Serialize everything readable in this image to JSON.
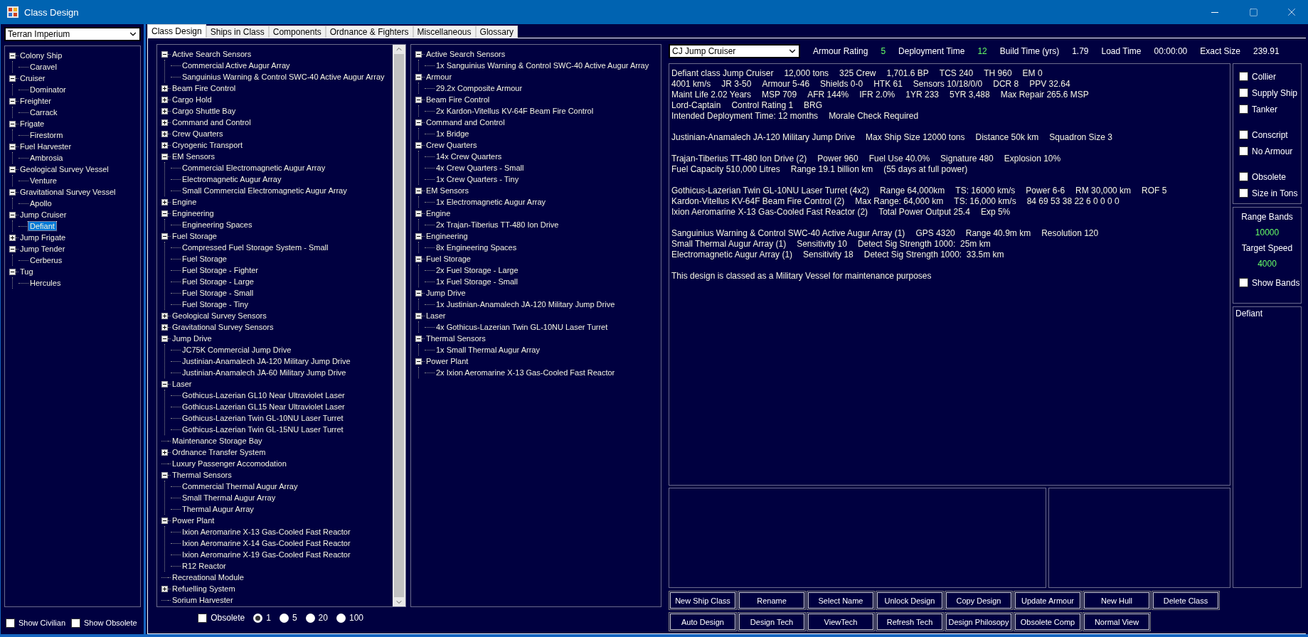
{
  "window": {
    "title": "Class Design"
  },
  "faction_select": {
    "value": "Terran Imperium"
  },
  "hull_tree": [
    {
      "label": "Colony Ship",
      "expanded": true,
      "selected": false,
      "children": [
        {
          "label": "Caravel",
          "selected": false
        }
      ]
    },
    {
      "label": "Cruiser",
      "expanded": true,
      "selected": false,
      "children": [
        {
          "label": "Dominator",
          "selected": false
        }
      ]
    },
    {
      "label": "Freighter",
      "expanded": true,
      "selected": false,
      "children": [
        {
          "label": "Carrack",
          "selected": false
        }
      ]
    },
    {
      "label": "Frigate",
      "expanded": true,
      "selected": false,
      "children": [
        {
          "label": "Firestorm",
          "selected": false
        }
      ]
    },
    {
      "label": "Fuel Harvester",
      "expanded": true,
      "selected": false,
      "children": [
        {
          "label": "Ambrosia",
          "selected": false
        }
      ]
    },
    {
      "label": "Geological Survey Vessel",
      "expanded": true,
      "selected": false,
      "children": [
        {
          "label": "Venture",
          "selected": false
        }
      ]
    },
    {
      "label": "Gravitational Survey Vessel",
      "expanded": true,
      "selected": false,
      "children": [
        {
          "label": "Apollo",
          "selected": false
        }
      ]
    },
    {
      "label": "Jump Cruiser",
      "expanded": true,
      "selected": false,
      "children": [
        {
          "label": "Defiant",
          "selected": true
        }
      ]
    },
    {
      "label": "Jump Frigate",
      "expanded": false,
      "selected": false
    },
    {
      "label": "Jump Tender",
      "expanded": true,
      "selected": false,
      "children": [
        {
          "label": "Cerberus",
          "selected": false
        }
      ]
    },
    {
      "label": "Tug",
      "expanded": true,
      "selected": false,
      "children": [
        {
          "label": "Hercules",
          "selected": false
        }
      ]
    }
  ],
  "left_options": [
    {
      "label": "Show Civilian",
      "checked": false
    },
    {
      "label": "Show Obsolete",
      "checked": false
    }
  ],
  "tabs": [
    {
      "label": "Class Design",
      "selected": true
    },
    {
      "label": "Ships in Class",
      "selected": false
    },
    {
      "label": "Components",
      "selected": false
    },
    {
      "label": "Ordnance & Fighters",
      "selected": false
    },
    {
      "label": "Miscellaneous",
      "selected": false
    },
    {
      "label": "Glossary",
      "selected": false
    }
  ],
  "component_tree": [
    {
      "label": "Active Search Sensors",
      "kind": "group",
      "expanded": true,
      "children": [
        {
          "label": "Commercial Active Augur Array"
        },
        {
          "label": "Sanguinius Warning & Control SWC-40 Active Augur Array"
        }
      ]
    },
    {
      "label": "Beam Fire Control",
      "kind": "group",
      "expanded": false
    },
    {
      "label": "Cargo Hold",
      "kind": "group",
      "expanded": false
    },
    {
      "label": "Cargo Shuttle Bay",
      "kind": "group",
      "expanded": false
    },
    {
      "label": "Command and Control",
      "kind": "group",
      "expanded": false
    },
    {
      "label": "Crew Quarters",
      "kind": "group",
      "expanded": false
    },
    {
      "label": "Cryogenic Transport",
      "kind": "group",
      "expanded": false
    },
    {
      "label": "EM Sensors",
      "kind": "group",
      "expanded": true,
      "children": [
        {
          "label": "Commercial Electromagnetic Augur Array"
        },
        {
          "label": "Electromagnetic Augur Array"
        },
        {
          "label": "Small Commercial Electromagnetic Augur Array"
        }
      ]
    },
    {
      "label": "Engine",
      "kind": "group",
      "expanded": false
    },
    {
      "label": "Engineering",
      "kind": "group",
      "expanded": true,
      "children": [
        {
          "label": "Engineering Spaces"
        }
      ]
    },
    {
      "label": "Fuel Storage",
      "kind": "group",
      "expanded": true,
      "children": [
        {
          "label": "Compressed Fuel Storage System - Small"
        },
        {
          "label": "Fuel Storage"
        },
        {
          "label": "Fuel Storage - Fighter"
        },
        {
          "label": "Fuel Storage - Large"
        },
        {
          "label": "Fuel Storage - Small"
        },
        {
          "label": "Fuel Storage - Tiny"
        }
      ]
    },
    {
      "label": "Geological Survey Sensors",
      "kind": "group",
      "expanded": false
    },
    {
      "label": "Gravitational Survey Sensors",
      "kind": "group",
      "expanded": false
    },
    {
      "label": "Jump Drive",
      "kind": "group",
      "expanded": true,
      "children": [
        {
          "label": "JC75K Commercial Jump Drive"
        },
        {
          "label": "Justinian-Anamalech JA-120 Military Jump Drive"
        },
        {
          "label": "Justinian-Anamalech JA-60 Military Jump Drive"
        }
      ]
    },
    {
      "label": "Laser",
      "kind": "group",
      "expanded": true,
      "children": [
        {
          "label": "Gothicus-Lazerian GL10 Near Ultraviolet Laser"
        },
        {
          "label": "Gothicus-Lazerian GL15 Near Ultraviolet Laser"
        },
        {
          "label": "Gothicus-Lazerian Twin GL-10NU Laser Turret"
        },
        {
          "label": "Gothicus-Lazerian Twin GL-15NU Laser Turret"
        }
      ]
    },
    {
      "label": "Maintenance Storage Bay",
      "kind": "item"
    },
    {
      "label": "Ordnance Transfer System",
      "kind": "group",
      "expanded": false
    },
    {
      "label": "Luxury Passenger Accomodation",
      "kind": "item"
    },
    {
      "label": "Thermal Sensors",
      "kind": "group",
      "expanded": true,
      "children": [
        {
          "label": "Commercial Thermal Augur Array"
        },
        {
          "label": "Small Thermal Augur Array"
        },
        {
          "label": "Thermal Augur Array"
        }
      ]
    },
    {
      "label": "Power Plant",
      "kind": "group",
      "expanded": true,
      "children": [
        {
          "label": "Ixion Aeromarine X-13 Gas-Cooled Fast Reactor"
        },
        {
          "label": "Ixion Aeromarine X-14 Gas-Cooled Fast Reactor"
        },
        {
          "label": "Ixion Aeromarine X-19 Gas-Cooled Fast Reactor"
        },
        {
          "label": "R12 Reactor"
        }
      ]
    },
    {
      "label": "Recreational Module",
      "kind": "item"
    },
    {
      "label": "Refuelling System",
      "kind": "group",
      "expanded": false
    },
    {
      "label": "Sorium Harvester",
      "kind": "item"
    }
  ],
  "component_options": {
    "obsolete": {
      "label": "Obsolete",
      "checked": false
    },
    "counts": [
      {
        "label": "1",
        "selected": true
      },
      {
        "label": "5",
        "selected": false
      },
      {
        "label": "20",
        "selected": false
      },
      {
        "label": "100",
        "selected": false
      }
    ]
  },
  "design_tree": [
    {
      "label": "Active Search Sensors",
      "expanded": true,
      "children": [
        {
          "label": "1x Sanguinius Warning & Control SWC-40 Active Augur Array"
        }
      ]
    },
    {
      "label": "Armour",
      "expanded": true,
      "children": [
        {
          "label": "29.2x Composite Armour"
        }
      ]
    },
    {
      "label": "Beam Fire Control",
      "expanded": true,
      "children": [
        {
          "label": "2x Kardon-Vitellus KV-64F Beam Fire Control"
        }
      ]
    },
    {
      "label": "Command and Control",
      "expanded": true,
      "children": [
        {
          "label": "1x Bridge"
        }
      ]
    },
    {
      "label": "Crew Quarters",
      "expanded": true,
      "children": [
        {
          "label": "14x Crew Quarters"
        },
        {
          "label": "4x Crew Quarters - Small"
        },
        {
          "label": "1x Crew Quarters - Tiny"
        }
      ]
    },
    {
      "label": "EM Sensors",
      "expanded": true,
      "children": [
        {
          "label": "1x Electromagnetic Augur Array"
        }
      ]
    },
    {
      "label": "Engine",
      "expanded": true,
      "children": [
        {
          "label": "2x Trajan-Tiberius TT-480 Ion Drive"
        }
      ]
    },
    {
      "label": "Engineering",
      "expanded": true,
      "children": [
        {
          "label": "8x Engineering Spaces"
        }
      ]
    },
    {
      "label": "Fuel Storage",
      "expanded": true,
      "children": [
        {
          "label": "2x Fuel Storage - Large"
        },
        {
          "label": "1x Fuel Storage - Small"
        }
      ]
    },
    {
      "label": "Jump Drive",
      "expanded": true,
      "children": [
        {
          "label": "1x Justinian-Anamalech JA-120 Military Jump Drive"
        }
      ]
    },
    {
      "label": "Laser",
      "expanded": true,
      "children": [
        {
          "label": "4x Gothicus-Lazerian Twin GL-10NU Laser Turret"
        }
      ]
    },
    {
      "label": "Thermal Sensors",
      "expanded": true,
      "children": [
        {
          "label": "1x Small Thermal Augur Array"
        }
      ]
    },
    {
      "label": "Power Plant",
      "expanded": true,
      "children": [
        {
          "label": "2x Ixion Aeromarine X-13 Gas-Cooled Fast Reactor"
        }
      ]
    }
  ],
  "class_select": {
    "value": "CJ Jump Cruiser"
  },
  "stats": [
    {
      "label": "Armour Rating",
      "value": "5",
      "color": "#66ff66"
    },
    {
      "label": "Deployment Time",
      "value": "12",
      "color": "#66ff66"
    },
    {
      "label": "Build Time (yrs)",
      "value": "1.79",
      "color": "#ffffff"
    },
    {
      "label": "Load Time",
      "value": "00:00:00",
      "color": "#ffffff"
    },
    {
      "label": "Exact Size",
      "value": "239.91",
      "color": "#ffffff"
    }
  ],
  "summary": [
    [
      [
        "Defiant class Jump Cruiser",
        "12,000 tons",
        "325 Crew",
        "1,701.6 BP",
        "TCS 240",
        "TH 960",
        "EM 0"
      ],
      [
        "4001 km/s",
        "JR 3-50",
        "Armour 5-46",
        "Shields 0-0",
        "HTK 61",
        "Sensors 10/18/0/0",
        "DCR 8",
        "PPV 32.64"
      ],
      [
        "Maint Life 2.02 Years",
        "MSP 709",
        "AFR 144%",
        "IFR 2.0%",
        "1YR 233",
        "5YR 3,488",
        "Max Repair 265.6 MSP"
      ],
      [
        "Lord-Captain",
        "Control Rating 1",
        "BRG"
      ],
      [
        "Intended Deployment Time: 12 months",
        "Morale Check Required"
      ]
    ],
    [
      [
        "Justinian-Anamalech JA-120 Military Jump Drive",
        "Max Ship Size 12000 tons",
        "Distance 50k km",
        "Squadron Size 3"
      ]
    ],
    [
      [
        "Trajan-Tiberius TT-480 Ion Drive (2)",
        "Power 960",
        "Fuel Use 40.0%",
        "Signature 480",
        "Explosion 10%"
      ],
      [
        "Fuel Capacity 510,000 Litres",
        "Range 19.1 billion km",
        "(55 days at full power)"
      ]
    ],
    [
      [
        "Gothicus-Lazerian Twin GL-10NU Laser Turret (4x2)",
        "Range 64,000km",
        "TS: 16000 km/s",
        "Power 6-6",
        "RM 30,000 km",
        "ROF 5"
      ],
      [
        "Kardon-Vitellus KV-64F Beam Fire Control (2)",
        "Max Range: 64,000 km",
        "TS: 16,000 km/s",
        "84 69 53 38 22 6 0 0 0 0"
      ],
      [
        "Ixion Aeromarine X-13 Gas-Cooled Fast Reactor (2)",
        "Total Power Output 25.4",
        "Exp 5%"
      ]
    ],
    [
      [
        "Sanguinius Warning & Control SWC-40 Active Augur Array (1)",
        "GPS 4320",
        "Range 40.9m km",
        "Resolution 120"
      ],
      [
        "Small Thermal Augur Array (1)",
        "Sensitivity 10",
        "Detect Sig Strength 1000:  25m km"
      ],
      [
        "Electromagnetic Augur Array (1)",
        "Sensitivity 18",
        "Detect Sig Strength 1000:  33.5m km"
      ]
    ],
    [
      [
        "This design is classed as a Military Vessel for maintenance purposes"
      ]
    ]
  ],
  "flags": [
    [
      {
        "label": "Collier",
        "checked": false
      },
      {
        "label": "Supply Ship",
        "checked": false
      },
      {
        "label": "Tanker",
        "checked": false
      }
    ],
    [
      {
        "label": "Conscript",
        "checked": false
      },
      {
        "label": "No Armour",
        "checked": false
      }
    ],
    [
      {
        "label": "Obsolete",
        "checked": false
      },
      {
        "label": "Size in Tons",
        "checked": false
      }
    ]
  ],
  "range_bands": {
    "label": "Range Bands",
    "value": "10000"
  },
  "target_speed": {
    "label": "Target Speed",
    "value": "4000"
  },
  "show_bands": {
    "label": "Show Bands",
    "checked": false
  },
  "notes": {
    "text": "Defiant"
  },
  "buttons": [
    [
      "New Ship Class",
      "Rename",
      "Select Name",
      "Unlock Design",
      "Copy Design",
      "Update Armour",
      "New Hull",
      "Delete Class"
    ],
    [
      "Auto Design",
      "Design Tech",
      "ViewTech",
      "Refresh Tech",
      "Design Philosopy",
      "Obsolete Comp",
      "Normal View"
    ]
  ]
}
